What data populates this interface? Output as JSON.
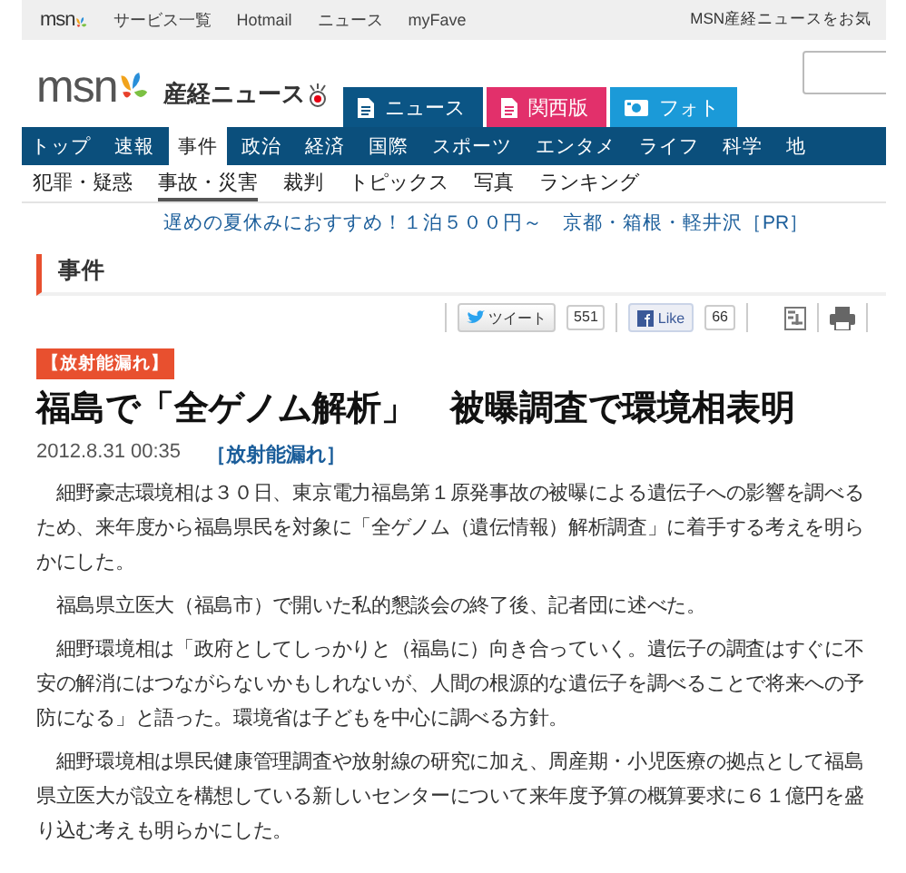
{
  "top_bar": {
    "logo": "msn",
    "links": [
      "サービス一覧",
      "Hotmail",
      "ニュース",
      "myFave"
    ],
    "notice": "MSN産経ニュースをお気"
  },
  "masthead": {
    "logo": "msn",
    "brand": "産経ニュース",
    "tabs": [
      {
        "label": "ニュース",
        "color": "#0b5585",
        "kind": "doc"
      },
      {
        "label": "関西版",
        "color": "#e2306b",
        "kind": "doc"
      },
      {
        "label": "フォト",
        "color": "#1b9ad8",
        "kind": "camera"
      }
    ]
  },
  "nav": [
    {
      "label": "トップ",
      "selected": false
    },
    {
      "label": "速報",
      "selected": false
    },
    {
      "label": "事件",
      "selected": true
    },
    {
      "label": "政治",
      "selected": false
    },
    {
      "label": "経済",
      "selected": false
    },
    {
      "label": "国際",
      "selected": false
    },
    {
      "label": "スポーツ",
      "selected": false
    },
    {
      "label": "エンタメ",
      "selected": false
    },
    {
      "label": "ライフ",
      "selected": false
    },
    {
      "label": "科学",
      "selected": false
    },
    {
      "label": "地",
      "selected": false
    }
  ],
  "sub_nav": [
    {
      "label": "犯罪・疑惑",
      "selected": false
    },
    {
      "label": "事故・災害",
      "selected": true
    },
    {
      "label": "裁判",
      "selected": false
    },
    {
      "label": "トピックス",
      "selected": false
    },
    {
      "label": "写真",
      "selected": false
    },
    {
      "label": "ランキング",
      "selected": false
    }
  ],
  "promo": "遅めの夏休みにおすすめ！１泊５００円～　京都・箱根・軽井沢［PR］",
  "section_title": "事件",
  "share": {
    "tweet": "ツイート",
    "tweet_count": "551",
    "like": "Like",
    "like_count": "66"
  },
  "article": {
    "tag": "【放射能漏れ】",
    "headline": "福島で「全ゲノム解析」　被曝調査で環境相表明",
    "date": "2012.8.31 00:35",
    "category": "［放射能漏れ］",
    "paragraphs": [
      "　細野豪志環境相は３０日、東京電力福島第１原発事故の被曝による遺伝子への影響を調べるため、来年度から福島県民を対象に「全ゲノム（遺伝情報）解析調査」に着手する考えを明らかにした。",
      "　福島県立医大（福島市）で開いた私的懇談会の終了後、記者団に述べた。",
      "　細野環境相は「政府としてしっかりと（福島に）向き合っていく。遺伝子の調査はすぐに不安の解消にはつながらないかもしれないが、人間の根源的な遺伝子を調べることで将来への予防になる」と語った。環境省は子どもを中心に調べる方針。",
      "　細野環境相は県民健康管理調査や放射線の研究に加え、周産期・小児医療の拠点として福島県立医大が設立を構想している新しいセンターについて来年度予算の概算要求に６１億円を盛り込む考えも明らかにした。"
    ]
  }
}
